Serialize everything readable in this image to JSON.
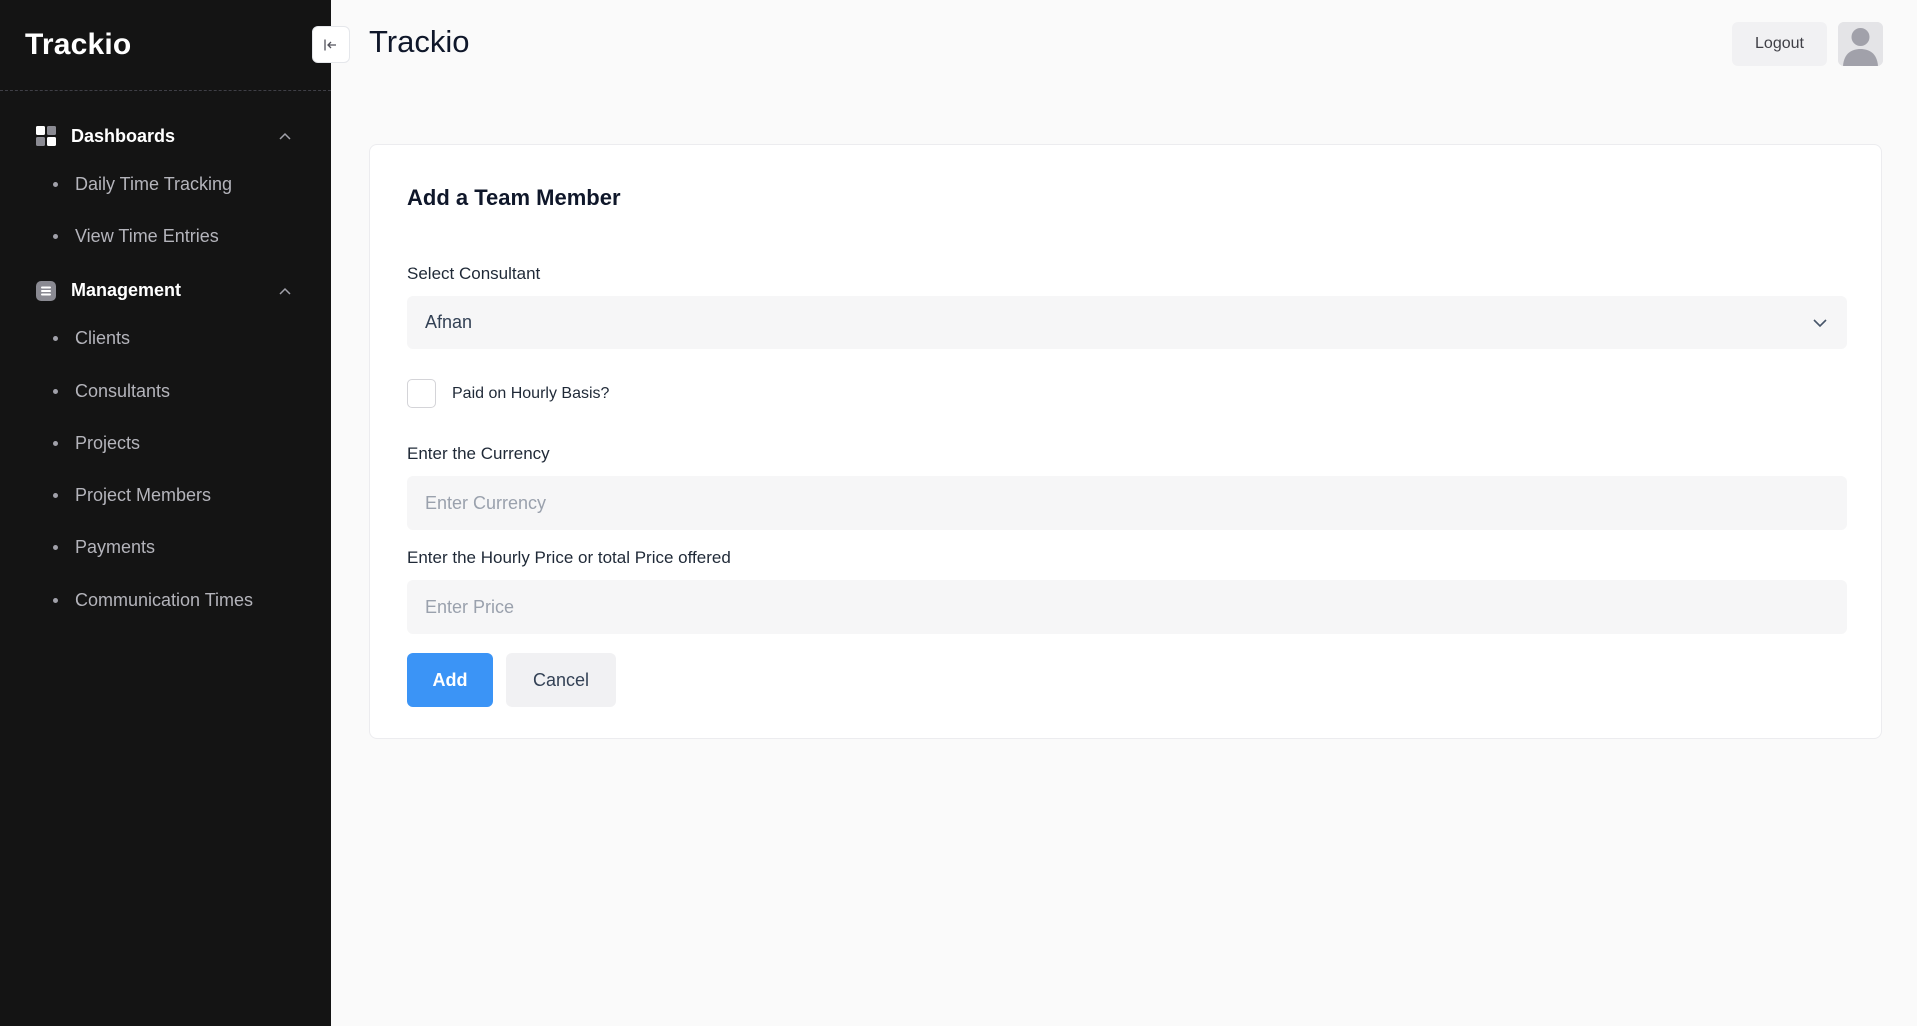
{
  "sidebar": {
    "brand": "Trackio",
    "collapse_icon": "arrow-left-icon",
    "groups": [
      {
        "label": "Dashboards",
        "icon": "grid-icon",
        "items": [
          {
            "label": "Daily Time Tracking"
          },
          {
            "label": "View Time Entries"
          }
        ]
      },
      {
        "label": "Management",
        "icon": "list-icon",
        "items": [
          {
            "label": "Clients"
          },
          {
            "label": "Consultants"
          },
          {
            "label": "Projects"
          },
          {
            "label": "Project Members"
          },
          {
            "label": "Payments"
          },
          {
            "label": "Communication Times"
          }
        ]
      }
    ]
  },
  "header": {
    "title": "Trackio",
    "logout_label": "Logout"
  },
  "form": {
    "title": "Add a Team Member",
    "consultant": {
      "label": "Select Consultant",
      "value": "Afnan"
    },
    "hourly": {
      "label": "Paid on Hourly Basis?",
      "checked": false
    },
    "currency": {
      "label": "Enter the Currency",
      "placeholder": "Enter Currency",
      "value": ""
    },
    "price": {
      "label": "Enter the Hourly Price or total Price offered",
      "placeholder": "Enter Price",
      "value": ""
    },
    "add_label": "Add",
    "cancel_label": "Cancel"
  },
  "colors": {
    "sidebar_bg": "#141414",
    "primary": "#3b94f6",
    "page_bg": "#fafafa"
  }
}
